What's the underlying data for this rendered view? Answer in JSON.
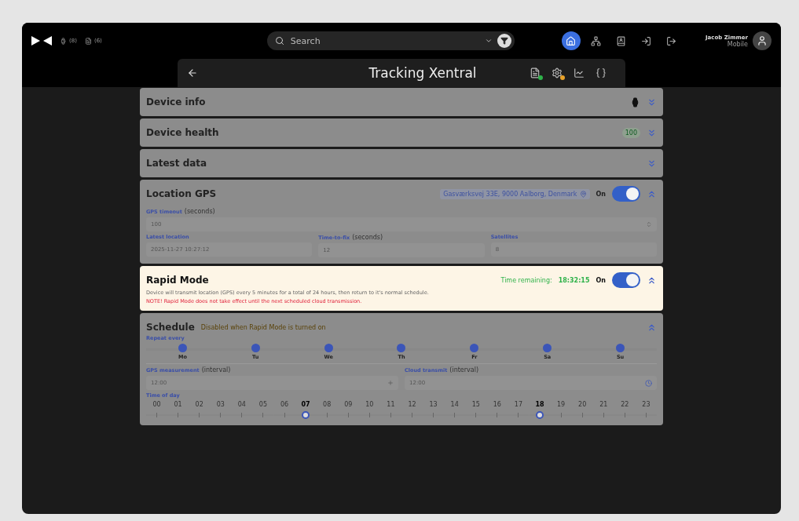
{
  "header": {
    "counts": [
      "(8)",
      "(6)"
    ],
    "search": {
      "placeholder": "Search"
    },
    "nav": [
      {
        "kind": "home",
        "selected": true
      },
      {
        "kind": "network",
        "selected": false
      },
      {
        "kind": "contact",
        "selected": false
      },
      {
        "kind": "login",
        "selected": false
      },
      {
        "kind": "logout",
        "selected": false
      }
    ],
    "user": {
      "name": "Jacob Zimmer",
      "role": "Mobile"
    }
  },
  "title": "Tracking Xentral",
  "sections": [
    {
      "kind": "info",
      "title": "Device info",
      "dimmed": true,
      "expanded": false
    },
    {
      "kind": "health",
      "title": "Device health",
      "badge": "100",
      "dimmed": true,
      "expanded": false
    },
    {
      "kind": "latest",
      "title": "Latest data",
      "dimmed": true,
      "expanded": false
    },
    {
      "kind": "gps",
      "title": "Location GPS",
      "address": "Gasværksvej 33E, 9000 Aalborg, Denmark",
      "toggle_label": "On",
      "on": true,
      "dimmed": true,
      "expanded": true,
      "timeout": {
        "label": "GPS timeout",
        "unit": "(seconds)",
        "value": "100"
      },
      "fields": [
        {
          "label": "Latest location",
          "value": "2025-11-27 10:27:12"
        },
        {
          "label": "Time-to-fix",
          "unit": "(seconds)",
          "value": "12"
        },
        {
          "label": "Satellites",
          "value": "8"
        }
      ]
    },
    {
      "kind": "rapid",
      "title": "Rapid Mode",
      "remaining_label": "Time remaining:",
      "remaining": "18:32:15",
      "toggle_label": "On",
      "on": true,
      "dimmed": false,
      "expanded": true,
      "description": "Device will transmit location (GPS) every 5 minutes for a total of 24 hours, then return to it's normal schedule.",
      "note": "NOTE! Rapid Mode does not take effect until the next scheduled cloud transmission."
    },
    {
      "kind": "schedule",
      "title": "Schedule",
      "hint": "Disabled when Rapid Mode is turned on",
      "dimmed": true,
      "expanded": true,
      "repeat_label": "Repeat every",
      "days": [
        {
          "label": "Mo",
          "selected": true
        },
        {
          "label": "Tu",
          "selected": true
        },
        {
          "label": "We",
          "selected": true
        },
        {
          "label": "Th",
          "selected": true
        },
        {
          "label": "Fr",
          "selected": true
        },
        {
          "label": "Sa",
          "selected": true
        },
        {
          "label": "Su",
          "selected": true
        }
      ],
      "intervals": [
        {
          "label": "GPS measurement",
          "unit": "(interval)",
          "value": "12:00"
        },
        {
          "label": "Cloud transmit",
          "unit": "(interval)",
          "value": "12:00"
        }
      ],
      "time_label": "Time of day",
      "hours": [
        {
          "label": "00",
          "selected": false
        },
        {
          "label": "01",
          "selected": false
        },
        {
          "label": "02",
          "selected": false
        },
        {
          "label": "03",
          "selected": false
        },
        {
          "label": "04",
          "selected": false
        },
        {
          "label": "05",
          "selected": false
        },
        {
          "label": "06",
          "selected": false
        },
        {
          "label": "07",
          "selected": true
        },
        {
          "label": "08",
          "selected": false
        },
        {
          "label": "09",
          "selected": false
        },
        {
          "label": "10",
          "selected": false
        },
        {
          "label": "11",
          "selected": false
        },
        {
          "label": "12",
          "selected": false
        },
        {
          "label": "13",
          "selected": false
        },
        {
          "label": "14",
          "selected": false
        },
        {
          "label": "15",
          "selected": false
        },
        {
          "label": "16",
          "selected": false
        },
        {
          "label": "17",
          "selected": false
        },
        {
          "label": "18",
          "selected": true
        },
        {
          "label": "19",
          "selected": false
        },
        {
          "label": "20",
          "selected": false
        },
        {
          "label": "21",
          "selected": false
        },
        {
          "label": "22",
          "selected": false
        },
        {
          "label": "23",
          "selected": false
        }
      ]
    }
  ]
}
